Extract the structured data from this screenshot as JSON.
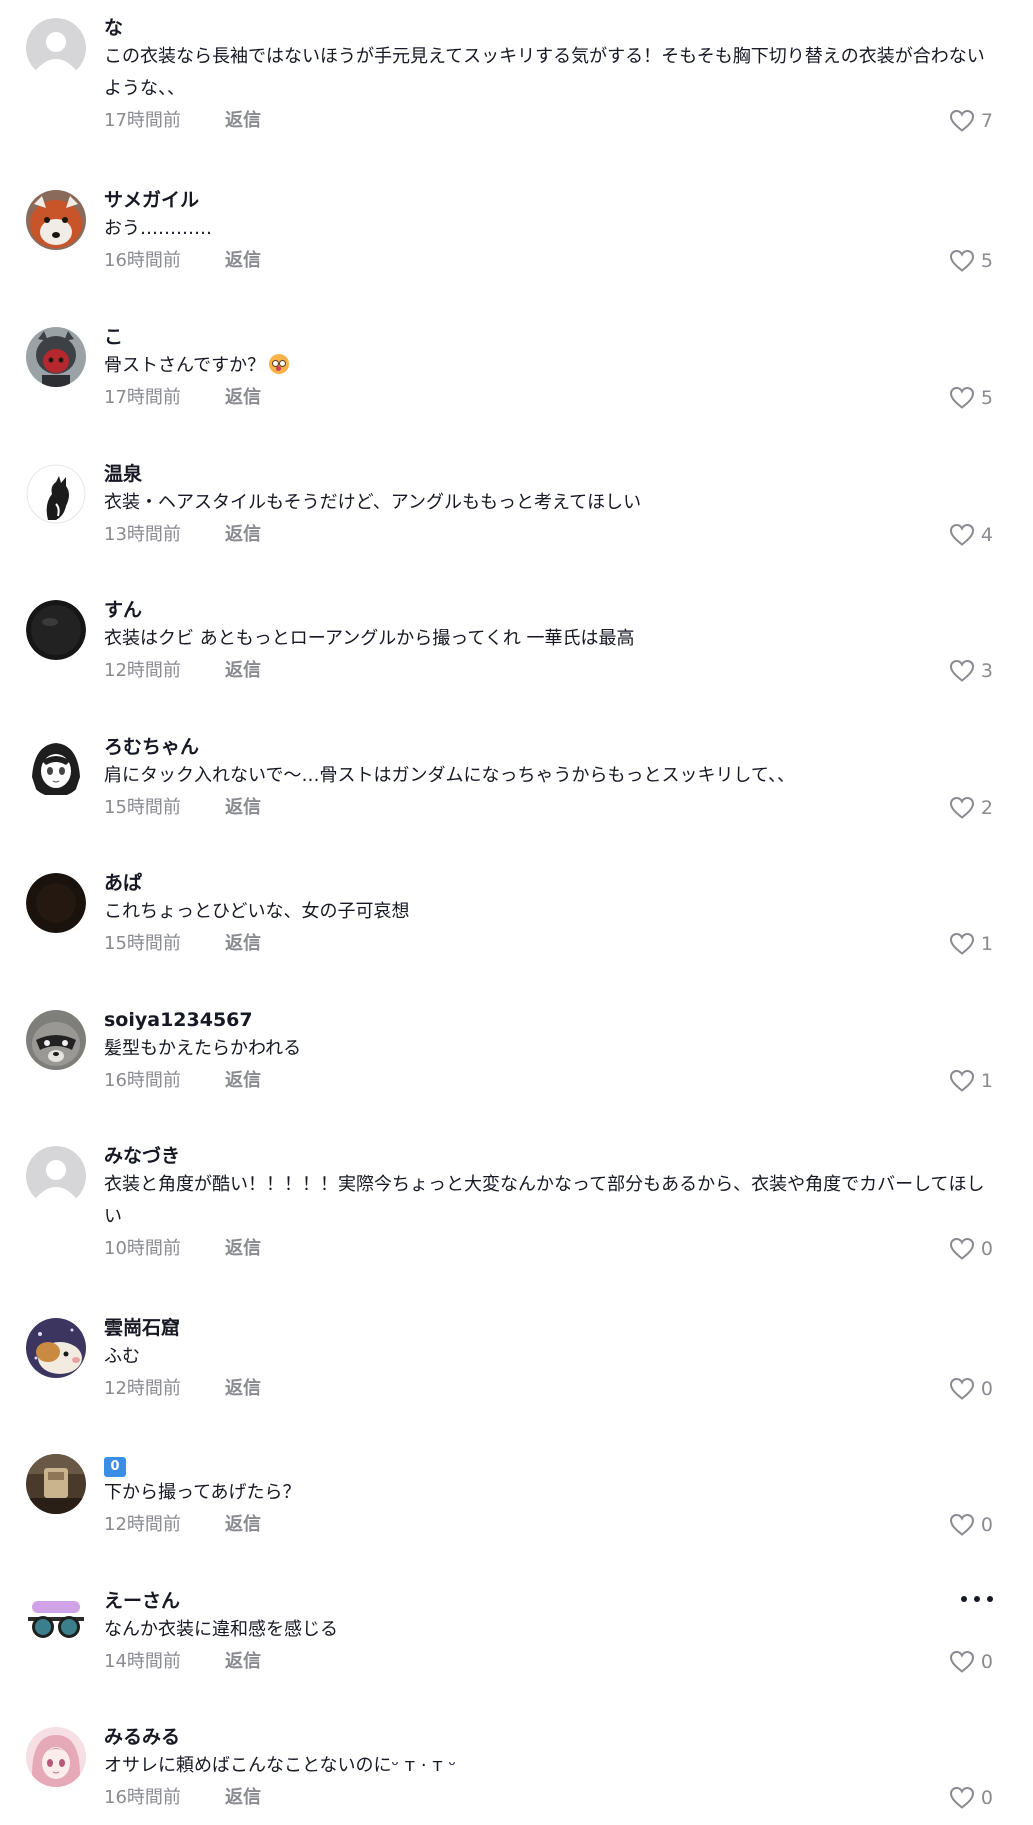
{
  "reply_label": "返信",
  "colors": {
    "username": "#161823",
    "text": "#161823",
    "meta": "#8a8b91",
    "badge": "#3a8ee6"
  },
  "comments": [
    {
      "username": "な",
      "text": "この衣装なら長袖ではないほうが手元見えてスッキリする気がする！そもそも胸下切り替えの衣装が合わないような、、",
      "time": "17時間前",
      "likes": "7",
      "avatar": "default-avatar-icon"
    },
    {
      "username": "サメガイル",
      "text": "おう…………",
      "time": "16時間前",
      "likes": "5",
      "avatar": "red-panda-photo"
    },
    {
      "username": "こ",
      "text": "骨ストさんですか？",
      "time": "17時間前",
      "likes": "5",
      "avatar": "figure-photo",
      "emoji": "flushed-face-emoji"
    },
    {
      "username": "温泉",
      "text": "衣装・ヘアスタイルもそうだけど、アングルももっと考えてほしい",
      "time": "13時間前",
      "likes": "4",
      "avatar": "cat-drawing"
    },
    {
      "username": "すん",
      "text": "衣装はクビ あともっとローアングルから撮ってくれ 一華氏は最高",
      "time": "12時間前",
      "likes": "3",
      "avatar": "dark-circle-avatar"
    },
    {
      "username": "ろむちゃん",
      "text": "肩にタック入れないで〜…骨ストはガンダムになっちゃうからもっとスッキリして、、",
      "time": "15時間前",
      "likes": "2",
      "avatar": "manga-girl-drawing"
    },
    {
      "username": "あぱ",
      "text": "これちょっとひどいな、女の子可哀想",
      "time": "15時間前",
      "likes": "1",
      "avatar": "dark-brown-avatar"
    },
    {
      "username": "soiya1234567",
      "text": "髪型もかえたらかわれる",
      "time": "16時間前",
      "likes": "1",
      "avatar": "raccoon-photo"
    },
    {
      "username": "みなづき",
      "text": "衣装と角度が酷い！！！！！実際今ちょっと大変なんかなって部分もあるから、衣装や角度でカバーしてほしい",
      "time": "10時間前",
      "likes": "0",
      "avatar": "default-avatar-icon"
    },
    {
      "username": "雲崗石窟",
      "text": "ふむ",
      "time": "12時間前",
      "likes": "0",
      "avatar": "guinea-pig-photo"
    },
    {
      "username": "0",
      "text": "下から撮ってあげたら？",
      "time": "12時間前",
      "likes": "0",
      "avatar": "cafe-photo",
      "username_is_badge": true
    },
    {
      "username": "えーさん",
      "text": "なんか衣装に違和感を感じる",
      "time": "14時間前",
      "likes": "0",
      "avatar": "sunglasses-sticker",
      "has_more_menu": true
    },
    {
      "username": "みるみる",
      "text": "オサレに頼めばこんなことないのにᵕ ᴛ · ᴛ ᵕ",
      "time": "16時間前",
      "likes": "0",
      "avatar": "pink-hair-girl-drawing"
    }
  ]
}
